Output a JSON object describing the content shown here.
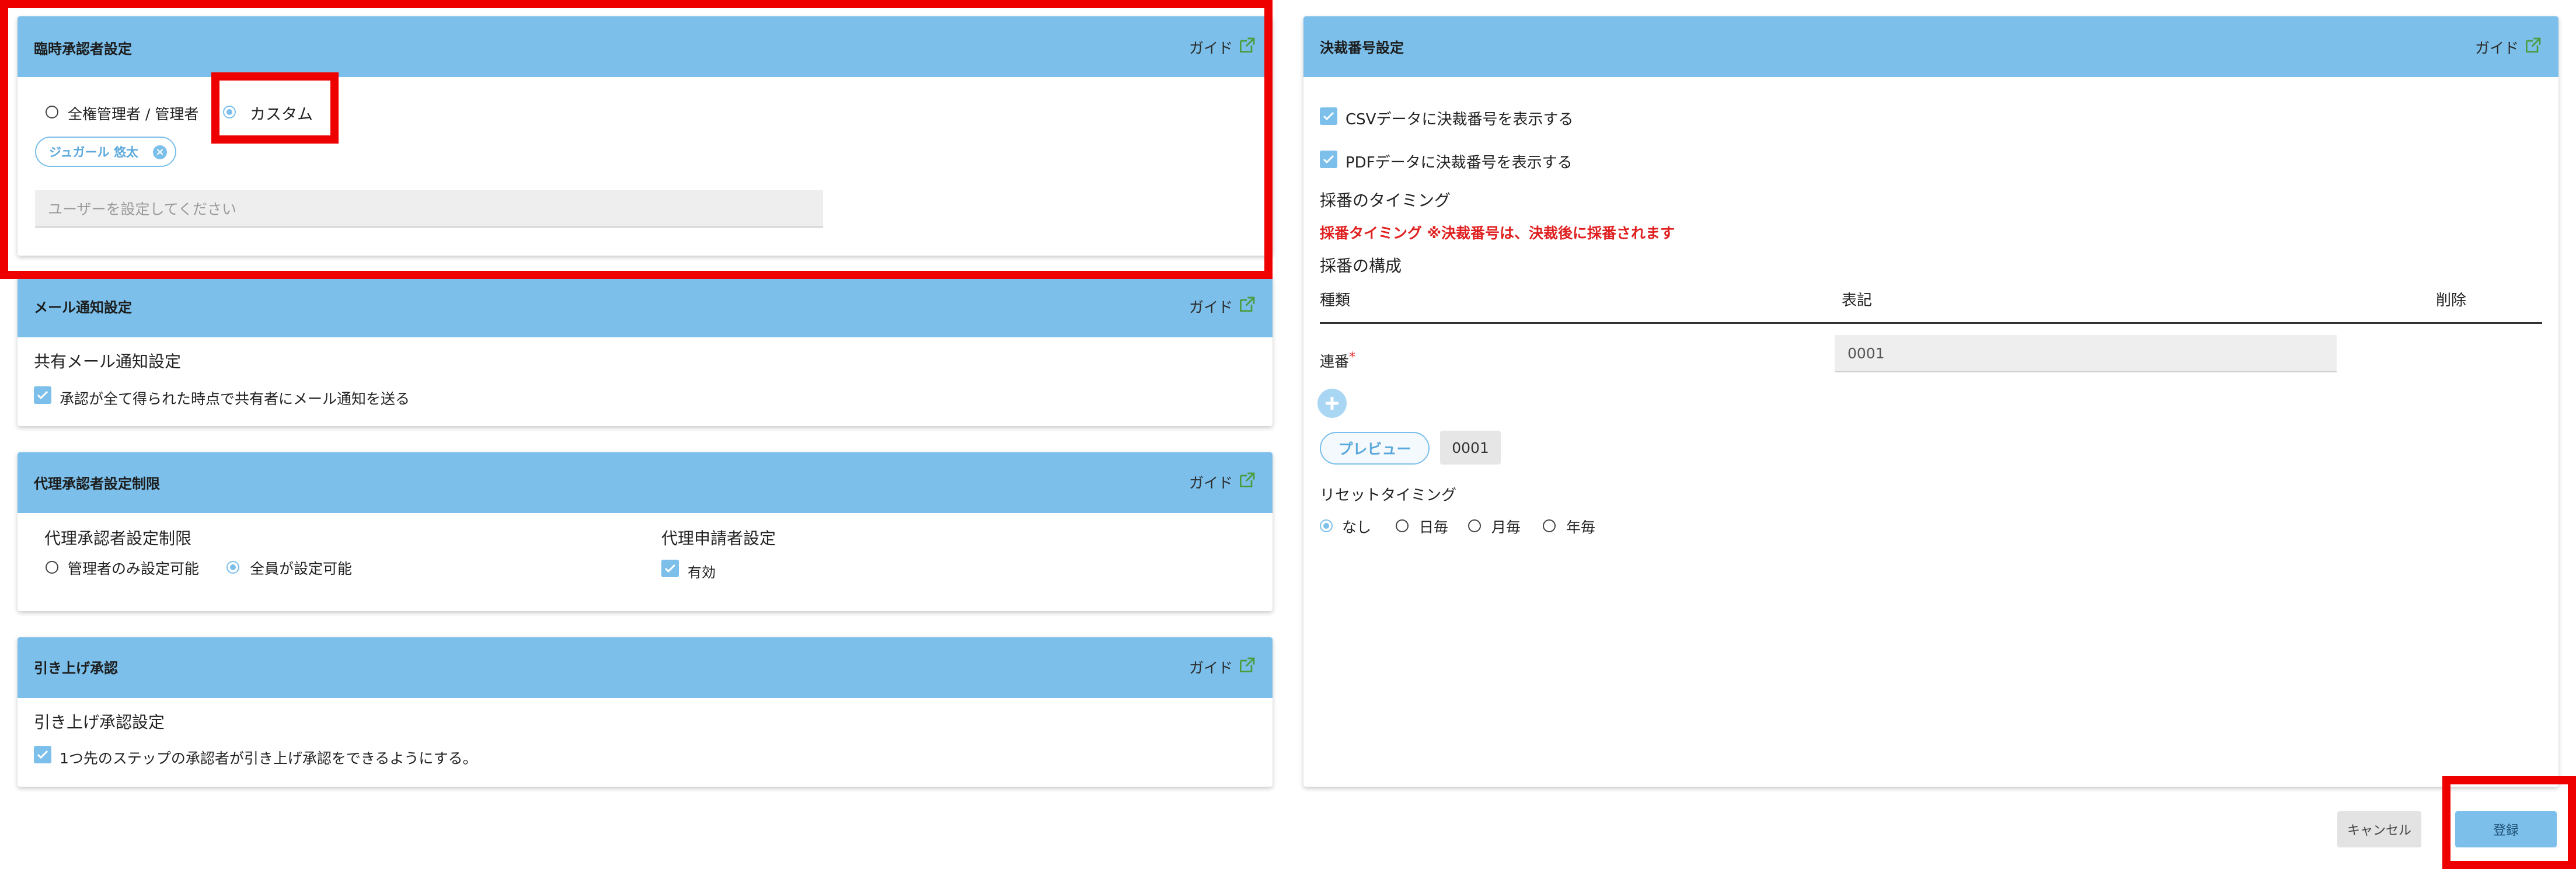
{
  "colors": {
    "header_bg": "#7bbfea",
    "accent": "#7bbfea",
    "highlight": "#ee0000",
    "warning_text": "#e02020"
  },
  "temp_approver": {
    "title": "臨時承認者設定",
    "guide": "ガイド",
    "option_all_admin": "全権管理者 / 管理者",
    "option_custom": "カスタム",
    "selected": "custom",
    "chip_user": "ジュガール 悠太",
    "user_placeholder": "ユーザーを設定してください"
  },
  "mail_notify": {
    "title": "メール通知設定",
    "guide": "ガイド",
    "section": "共有メール通知設定",
    "checkbox_label": "承認が全て得られた時点で共有者にメール通知を送る",
    "checked": true
  },
  "proxy_limit": {
    "title": "代理承認者設定制限",
    "guide": "ガイド",
    "section_left": "代理承認者設定制限",
    "option_admin_only": "管理者のみ設定可能",
    "option_everyone": "全員が設定可能",
    "selected": "everyone",
    "section_right": "代理申請者設定",
    "enabled_label": "有効",
    "enabled": true
  },
  "pull_up": {
    "title": "引き上げ承認",
    "guide": "ガイド",
    "section": "引き上げ承認設定",
    "checkbox_label": "1つ先のステップの承認者が引き上げ承認をできるようにする。",
    "checked": true
  },
  "decision_number": {
    "title": "決裁番号設定",
    "guide": "ガイド",
    "csv_label": "CSVデータに決裁番号を表示する",
    "csv_checked": true,
    "pdf_label": "PDFデータに決裁番号を表示する",
    "pdf_checked": true,
    "timing_heading": "採番のタイミング",
    "timing_note": "採番タイミング ※決裁番号は、決裁後に採番されます",
    "structure_heading": "採番の構成",
    "columns": [
      "種類",
      "表記",
      "削除"
    ],
    "rows": [
      {
        "type": "連番",
        "required_mark": "*",
        "notation": "0001"
      }
    ],
    "preview_button": "プレビュー",
    "preview_value": "0001",
    "reset_heading": "リセットタイミング",
    "reset_options": [
      "なし",
      "日毎",
      "月毎",
      "年毎"
    ],
    "reset_selected": 0
  },
  "footer": {
    "cancel": "キャンセル",
    "register": "登録"
  }
}
